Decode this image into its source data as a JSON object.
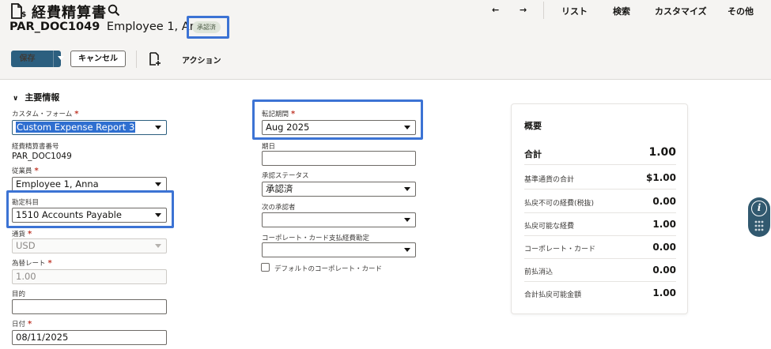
{
  "header": {
    "title": "経費精算書",
    "icons": {
      "title": "expense-doc-icon",
      "search": "search-icon"
    },
    "nav": {
      "back": "←",
      "forward": "→",
      "list": "リスト",
      "search": "検索",
      "customize": "カスタマイズ",
      "more": "その他"
    },
    "doc_id": "PAR_DOC1049",
    "employee_name": "Employee 1, Anna",
    "status_badge": "承認済"
  },
  "toolbar": {
    "save_label": "保存",
    "cancel_label": "キャンセル",
    "new_doc_icon": "add-document-icon",
    "action_label": "アクション"
  },
  "section": {
    "title": "主要情報"
  },
  "form": {
    "custom_form": {
      "label": "カスタム・フォーム",
      "value": "Custom Expense Report 3"
    },
    "doc_number": {
      "label": "経費精算書番号",
      "value": "PAR_DOC1049"
    },
    "employee": {
      "label": "従業員",
      "value": "Employee 1, Anna"
    },
    "account": {
      "label": "勘定科目",
      "value": "1510 Accounts Payable"
    },
    "currency": {
      "label": "通貨",
      "value": "USD"
    },
    "exchange_rate": {
      "label": "為替レート",
      "value": "1.00"
    },
    "purpose": {
      "label": "目的",
      "value": ""
    },
    "date": {
      "label": "日付",
      "value": "08/11/2025"
    },
    "posting_period": {
      "label": "転記期間",
      "value": "Aug 2025"
    },
    "due_date": {
      "label": "期日",
      "value": ""
    },
    "approval_status": {
      "label": "承認ステータス",
      "value": "承認済"
    },
    "next_approver": {
      "label": "次の承認者",
      "value": ""
    },
    "corp_card_account": {
      "label": "コーポレート・カード支払経費勘定",
      "value": ""
    },
    "default_corp_card": {
      "label": "デフォルトのコーポレート・カード",
      "checked": false
    }
  },
  "summary": {
    "title": "概要",
    "rows": [
      {
        "label": "合計",
        "value": "1.00"
      },
      {
        "label": "基準通貨の合計",
        "value": "$1.00"
      },
      {
        "label": "払戻不可の経費(税抜)",
        "value": "0.00"
      },
      {
        "label": "払戻可能な経費",
        "value": "1.00"
      },
      {
        "label": "コーポレート・カード",
        "value": "0.00"
      },
      {
        "label": "前払消込",
        "value": "0.00"
      },
      {
        "label": "合計払戻可能金額",
        "value": "1.00"
      }
    ]
  },
  "help_widget": {
    "icon": "info-icon"
  },
  "colors": {
    "primary": "#2c5f7f",
    "highlight": "#3c73d4",
    "required": "#c0392b",
    "badge_bg": "#dfe5da"
  }
}
